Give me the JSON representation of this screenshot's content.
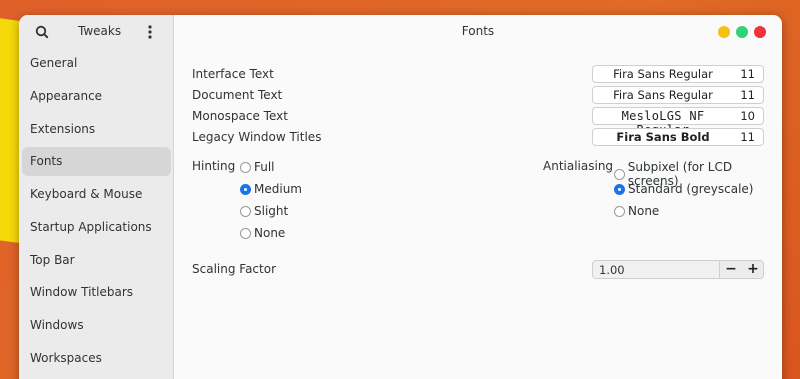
{
  "app": {
    "title": "Tweaks"
  },
  "page": {
    "title": "Fonts"
  },
  "window_controls": {
    "colors": [
      "#f5c211",
      "#33d17a",
      "#ed333b"
    ]
  },
  "sidebar": {
    "items": [
      {
        "label": "General"
      },
      {
        "label": "Appearance"
      },
      {
        "label": "Extensions"
      },
      {
        "label": "Fonts"
      },
      {
        "label": "Keyboard & Mouse"
      },
      {
        "label": "Startup Applications"
      },
      {
        "label": "Top Bar"
      },
      {
        "label": "Window Titlebars"
      },
      {
        "label": "Windows"
      },
      {
        "label": "Workspaces"
      }
    ],
    "selected": "Fonts"
  },
  "fonts": {
    "rows": [
      {
        "label": "Interface Text",
        "font": "Fira Sans Regular",
        "size": "11"
      },
      {
        "label": "Document Text",
        "font": "Fira Sans Regular",
        "size": "11"
      },
      {
        "label": "Monospace Text",
        "font": "MesloLGS NF Regular",
        "size": "10"
      },
      {
        "label": "Legacy Window Titles",
        "font": "Fira Sans Bold",
        "size": "11"
      }
    ]
  },
  "hinting": {
    "label": "Hinting",
    "options": [
      "Full",
      "Medium",
      "Slight",
      "None"
    ],
    "selected": "Medium"
  },
  "antialiasing": {
    "label": "Antialiasing",
    "options": [
      "Subpixel (for LCD screens)",
      "Standard (greyscale)",
      "None"
    ],
    "selected": "Standard (greyscale)"
  },
  "scaling": {
    "label": "Scaling Factor",
    "value": "1.00",
    "minus": "−",
    "plus": "+"
  }
}
